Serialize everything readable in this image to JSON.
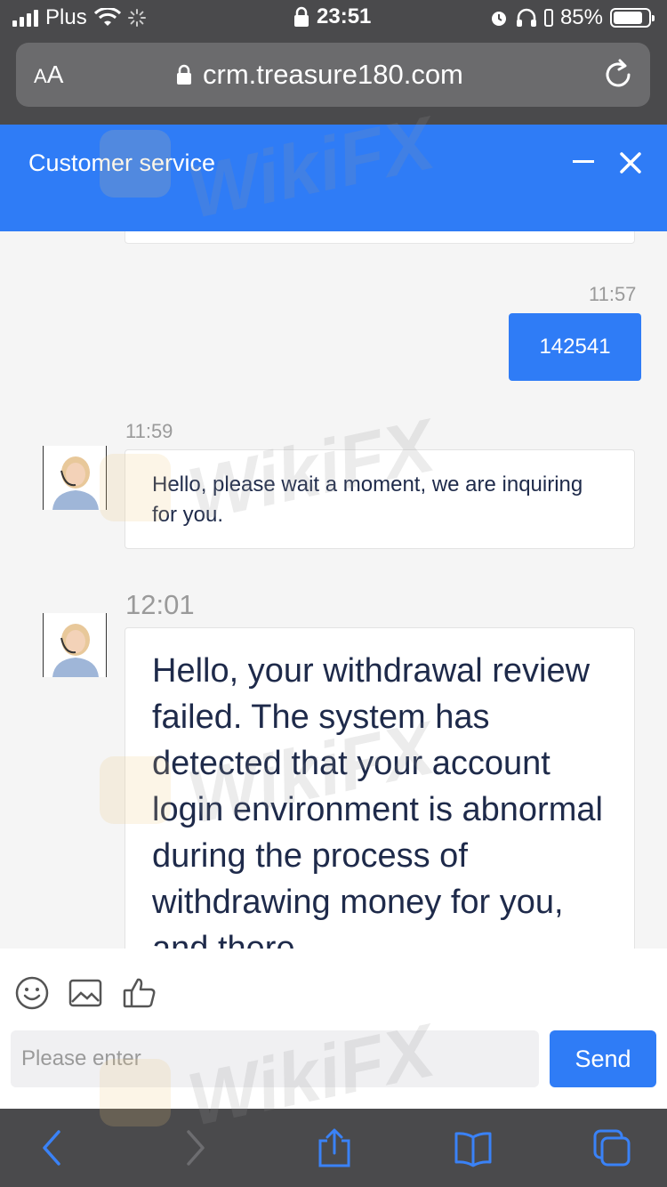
{
  "status_bar": {
    "carrier": "Plus",
    "time": "23:51",
    "battery": "85%",
    "battery_level": 0.85
  },
  "browser": {
    "text_size_label_small": "A",
    "text_size_label_large": "A",
    "url": "crm.treasure180.com"
  },
  "chat": {
    "title": "Customer service",
    "messages": [
      {
        "sender": "user",
        "time": "11:57",
        "text": "142541"
      },
      {
        "sender": "agent",
        "time": "11:59",
        "text": "Hello, please wait a moment, we are inquiring for you."
      },
      {
        "sender": "agent",
        "time": "12:01",
        "text": "Hello, your withdrawal review failed. The system has detected that your account login environment is abnormal during the process of withdrawing money for you, and there"
      }
    ]
  },
  "input": {
    "placeholder": "Please enter",
    "send_label": "Send"
  },
  "watermark": {
    "text": "WikiFX"
  },
  "colors": {
    "accent": "#2f7cf6",
    "browser_chrome": "#4a4a4c",
    "chat_bg": "#f5f5f5"
  }
}
